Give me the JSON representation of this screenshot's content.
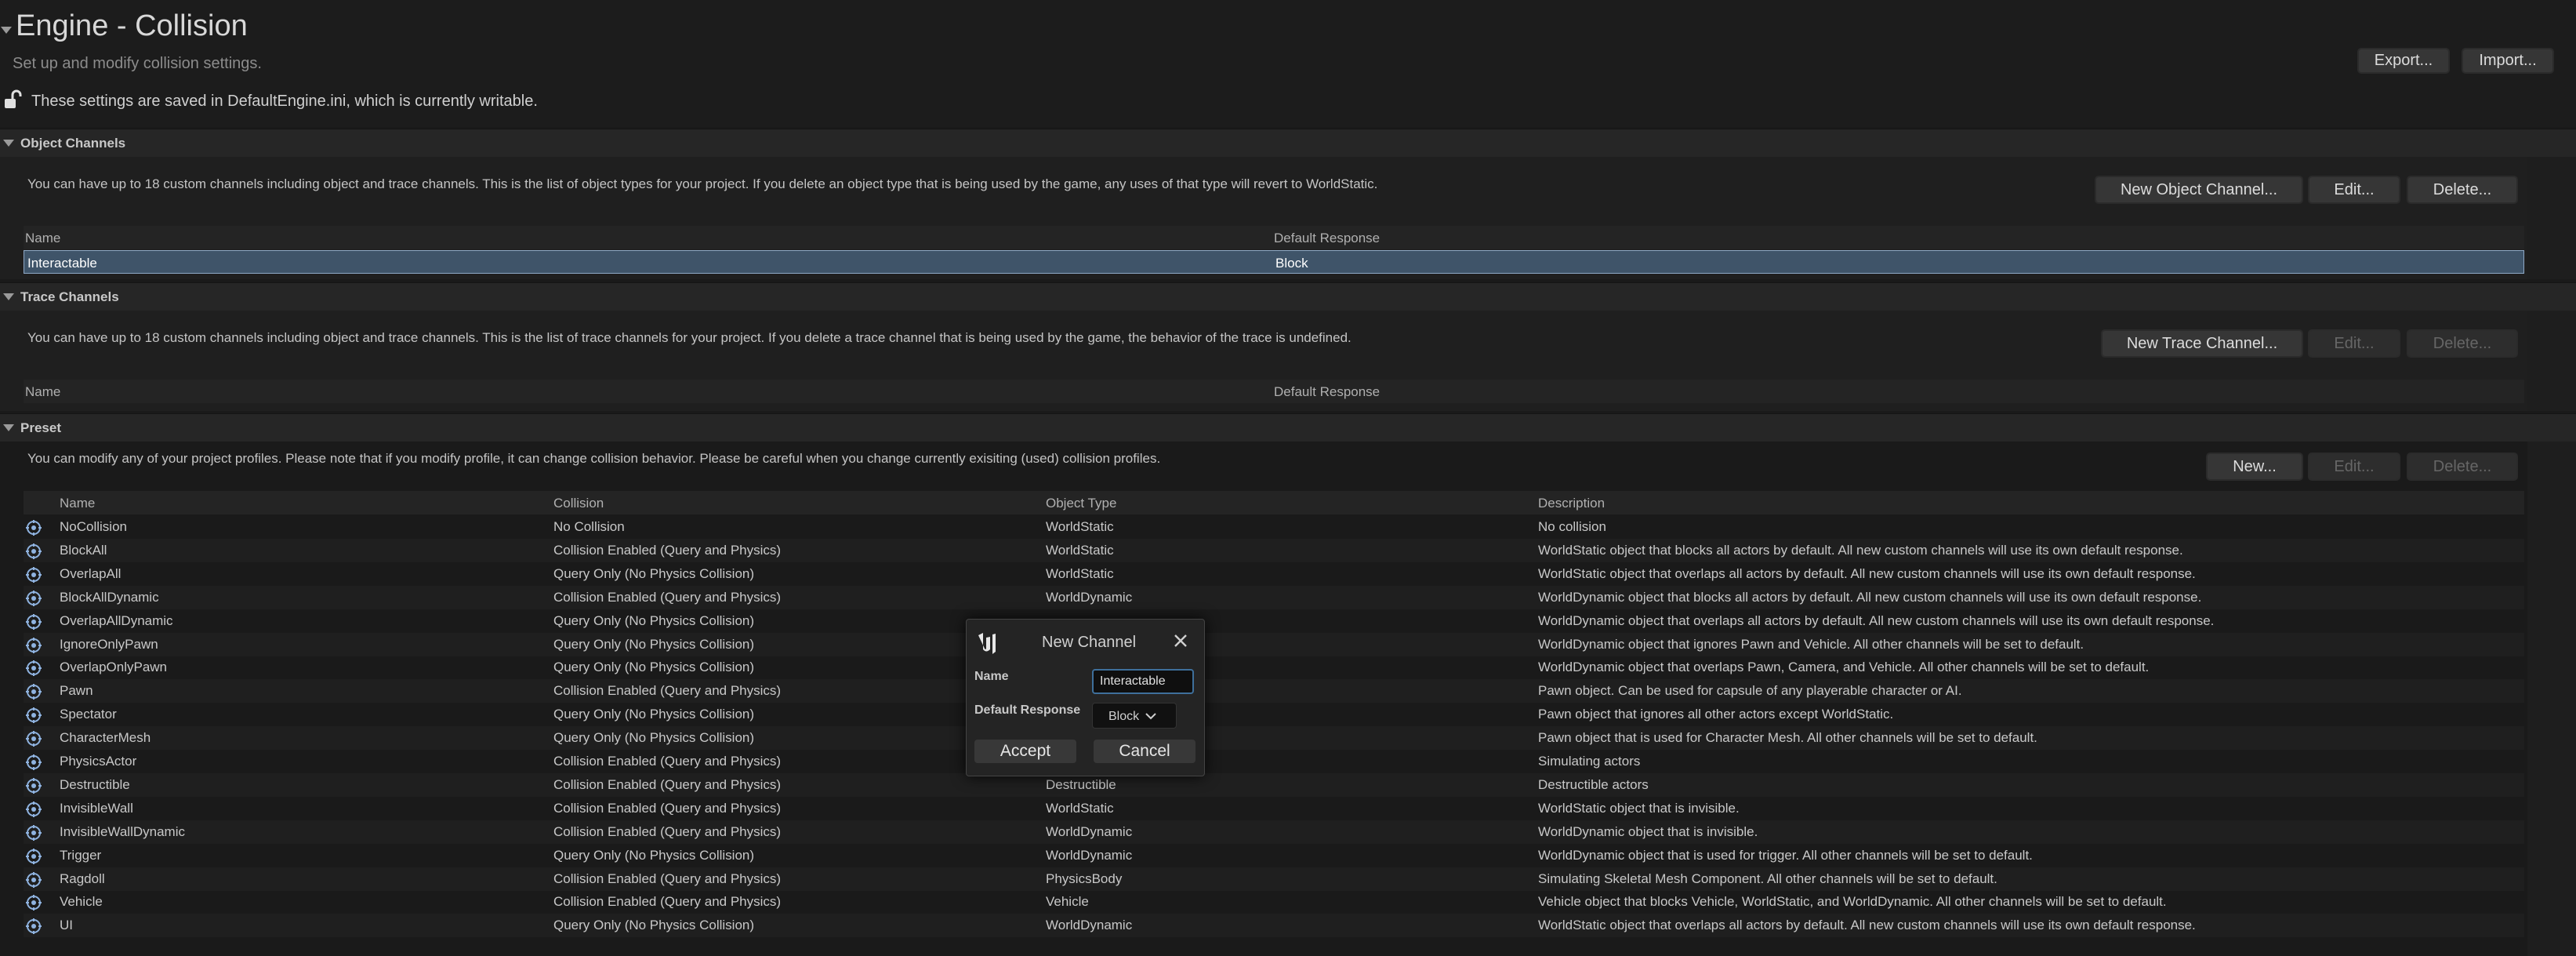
{
  "header": {
    "title": "Engine - Collision",
    "subtitle": "Set up and modify collision settings.",
    "settings_note": "These settings are saved in DefaultEngine.ini, which is currently writable.",
    "export_label": "Export...",
    "import_label": "Import..."
  },
  "object_channels": {
    "heading": "Object Channels",
    "description": "You can have up to 18 custom channels including object and trace channels. This is the list of object types for your project. If you delete an object type that is being used by the game, any uses of that type will revert to WorldStatic.",
    "new_label": "New Object Channel...",
    "edit_label": "Edit...",
    "delete_label": "Delete...",
    "col_name": "Name",
    "col_response": "Default Response",
    "rows": [
      {
        "name": "Interactable",
        "response": "Block"
      }
    ]
  },
  "trace_channels": {
    "heading": "Trace Channels",
    "description": "You can have up to 18 custom channels including object and trace channels. This is the list of trace channels for your project. If you delete a trace channel that is being used by the game, the behavior of the trace is undefined.",
    "new_label": "New Trace Channel...",
    "edit_label": "Edit...",
    "delete_label": "Delete...",
    "col_name": "Name",
    "col_response": "Default Response"
  },
  "preset": {
    "heading": "Preset",
    "description": "You can modify any of your project profiles. Please note that if you modify profile, it can change collision behavior. Please be careful when you change currently exisiting (used) collision profiles.",
    "new_label": "New...",
    "edit_label": "Edit...",
    "delete_label": "Delete...",
    "columns": {
      "name": "Name",
      "collision": "Collision",
      "object_type": "Object Type",
      "description": "Description"
    },
    "rows": [
      {
        "name": "NoCollision",
        "collision": "No Collision",
        "object_type": "WorldStatic",
        "description": "No collision"
      },
      {
        "name": "BlockAll",
        "collision": "Collision Enabled (Query and Physics)",
        "object_type": "WorldStatic",
        "description": "WorldStatic object that blocks all actors by default. All new custom channels will use its own default response."
      },
      {
        "name": "OverlapAll",
        "collision": "Query Only (No Physics Collision)",
        "object_type": "WorldStatic",
        "description": "WorldStatic object that overlaps all actors by default. All new custom channels will use its own default response."
      },
      {
        "name": "BlockAllDynamic",
        "collision": "Collision Enabled (Query and Physics)",
        "object_type": "WorldDynamic",
        "description": "WorldDynamic object that blocks all actors by default. All new custom channels will use its own default response."
      },
      {
        "name": "OverlapAllDynamic",
        "collision": "Query Only (No Physics Collision)",
        "object_type": "",
        "description": "WorldDynamic object that overlaps all actors by default. All new custom channels will use its own default response."
      },
      {
        "name": "IgnoreOnlyPawn",
        "collision": "Query Only (No Physics Collision)",
        "object_type": "",
        "description": "WorldDynamic object that ignores Pawn and Vehicle. All other channels will be set to default."
      },
      {
        "name": "OverlapOnlyPawn",
        "collision": "Query Only (No Physics Collision)",
        "object_type": "",
        "description": "WorldDynamic object that overlaps Pawn, Camera, and Vehicle. All other channels will be set to default."
      },
      {
        "name": "Pawn",
        "collision": "Collision Enabled (Query and Physics)",
        "object_type": "",
        "description": "Pawn object. Can be used for capsule of any playerable character or AI."
      },
      {
        "name": "Spectator",
        "collision": "Query Only (No Physics Collision)",
        "object_type": "",
        "description": "Pawn object that ignores all other actors except WorldStatic."
      },
      {
        "name": "CharacterMesh",
        "collision": "Query Only (No Physics Collision)",
        "object_type": "",
        "description": "Pawn object that is used for Character Mesh. All other channels will be set to default."
      },
      {
        "name": "PhysicsActor",
        "collision": "Collision Enabled (Query and Physics)",
        "object_type": "",
        "description": "Simulating actors"
      },
      {
        "name": "Destructible",
        "collision": "Collision Enabled (Query and Physics)",
        "object_type": "Destructible",
        "description": "Destructible actors"
      },
      {
        "name": "InvisibleWall",
        "collision": "Collision Enabled (Query and Physics)",
        "object_type": "WorldStatic",
        "description": "WorldStatic object that is invisible."
      },
      {
        "name": "InvisibleWallDynamic",
        "collision": "Collision Enabled (Query and Physics)",
        "object_type": "WorldDynamic",
        "description": "WorldDynamic object that is invisible."
      },
      {
        "name": "Trigger",
        "collision": "Query Only (No Physics Collision)",
        "object_type": "WorldDynamic",
        "description": "WorldDynamic object that is used for trigger. All other channels will be set to default."
      },
      {
        "name": "Ragdoll",
        "collision": "Collision Enabled (Query and Physics)",
        "object_type": "PhysicsBody",
        "description": "Simulating Skeletal Mesh Component. All other channels will be set to default."
      },
      {
        "name": "Vehicle",
        "collision": "Collision Enabled (Query and Physics)",
        "object_type": "Vehicle",
        "description": "Vehicle object that blocks Vehicle, WorldStatic, and WorldDynamic. All other channels will be set to default."
      },
      {
        "name": "UI",
        "collision": "Query Only (No Physics Collision)",
        "object_type": "WorldDynamic",
        "description": "WorldStatic object that overlaps all actors by default. All new custom channels will use its own default response."
      }
    ]
  },
  "dialog": {
    "title": "New Channel",
    "name_label": "Name",
    "name_value": "Interactable",
    "response_label": "Default Response",
    "response_value": "Block",
    "accept_label": "Accept",
    "cancel_label": "Cancel"
  }
}
